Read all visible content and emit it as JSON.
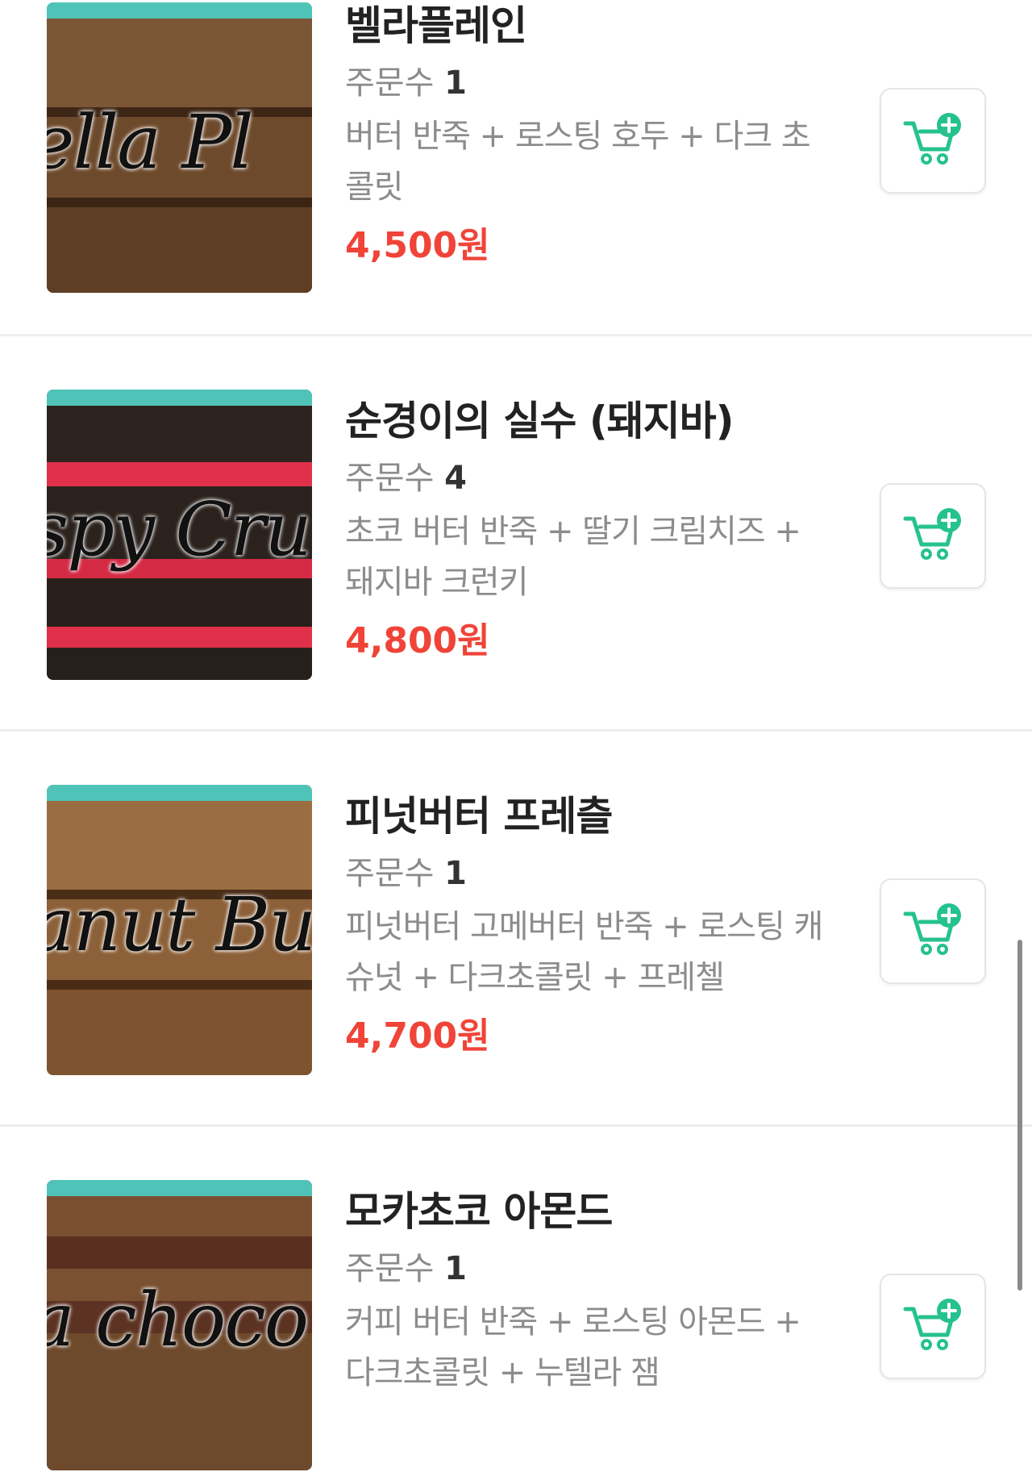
{
  "colors": {
    "price": "#f04438",
    "cart_accent": "#25c28f",
    "thumb_band": "#4fc3b8"
  },
  "items": [
    {
      "name": "벨라플레인",
      "orders_label": "주문수",
      "orders": "1",
      "desc": "버터 반죽 + 로스팅 호두 + 다크 초콜릿",
      "price": "4,500원",
      "image_text": "ella Pl"
    },
    {
      "name": "순경이의 실수 (돼지바)",
      "orders_label": "주문수",
      "orders": "4",
      "desc": "초코 버터 반죽 + 딸기 크림치즈 + 돼지바 크런키",
      "price": "4,800원",
      "image_text": "spy Cru"
    },
    {
      "name": "피넛버터 프레츨",
      "orders_label": "주문수",
      "orders": "1",
      "desc": "피넛버터 고메버터 반죽 + 로스팅 캐슈넛 + 다크초콜릿 + 프레첼",
      "price": "4,700원",
      "image_text": "anut Bu"
    },
    {
      "name": "모카초코 아몬드",
      "orders_label": "주문수",
      "orders": "1",
      "desc": "커피 버터 반죽 + 로스팅 아몬드 + 다크초콜릿 + 누텔라 잼",
      "price": "",
      "image_text": "a choco al"
    }
  ],
  "icons": {
    "cart": "cart-add-icon"
  }
}
